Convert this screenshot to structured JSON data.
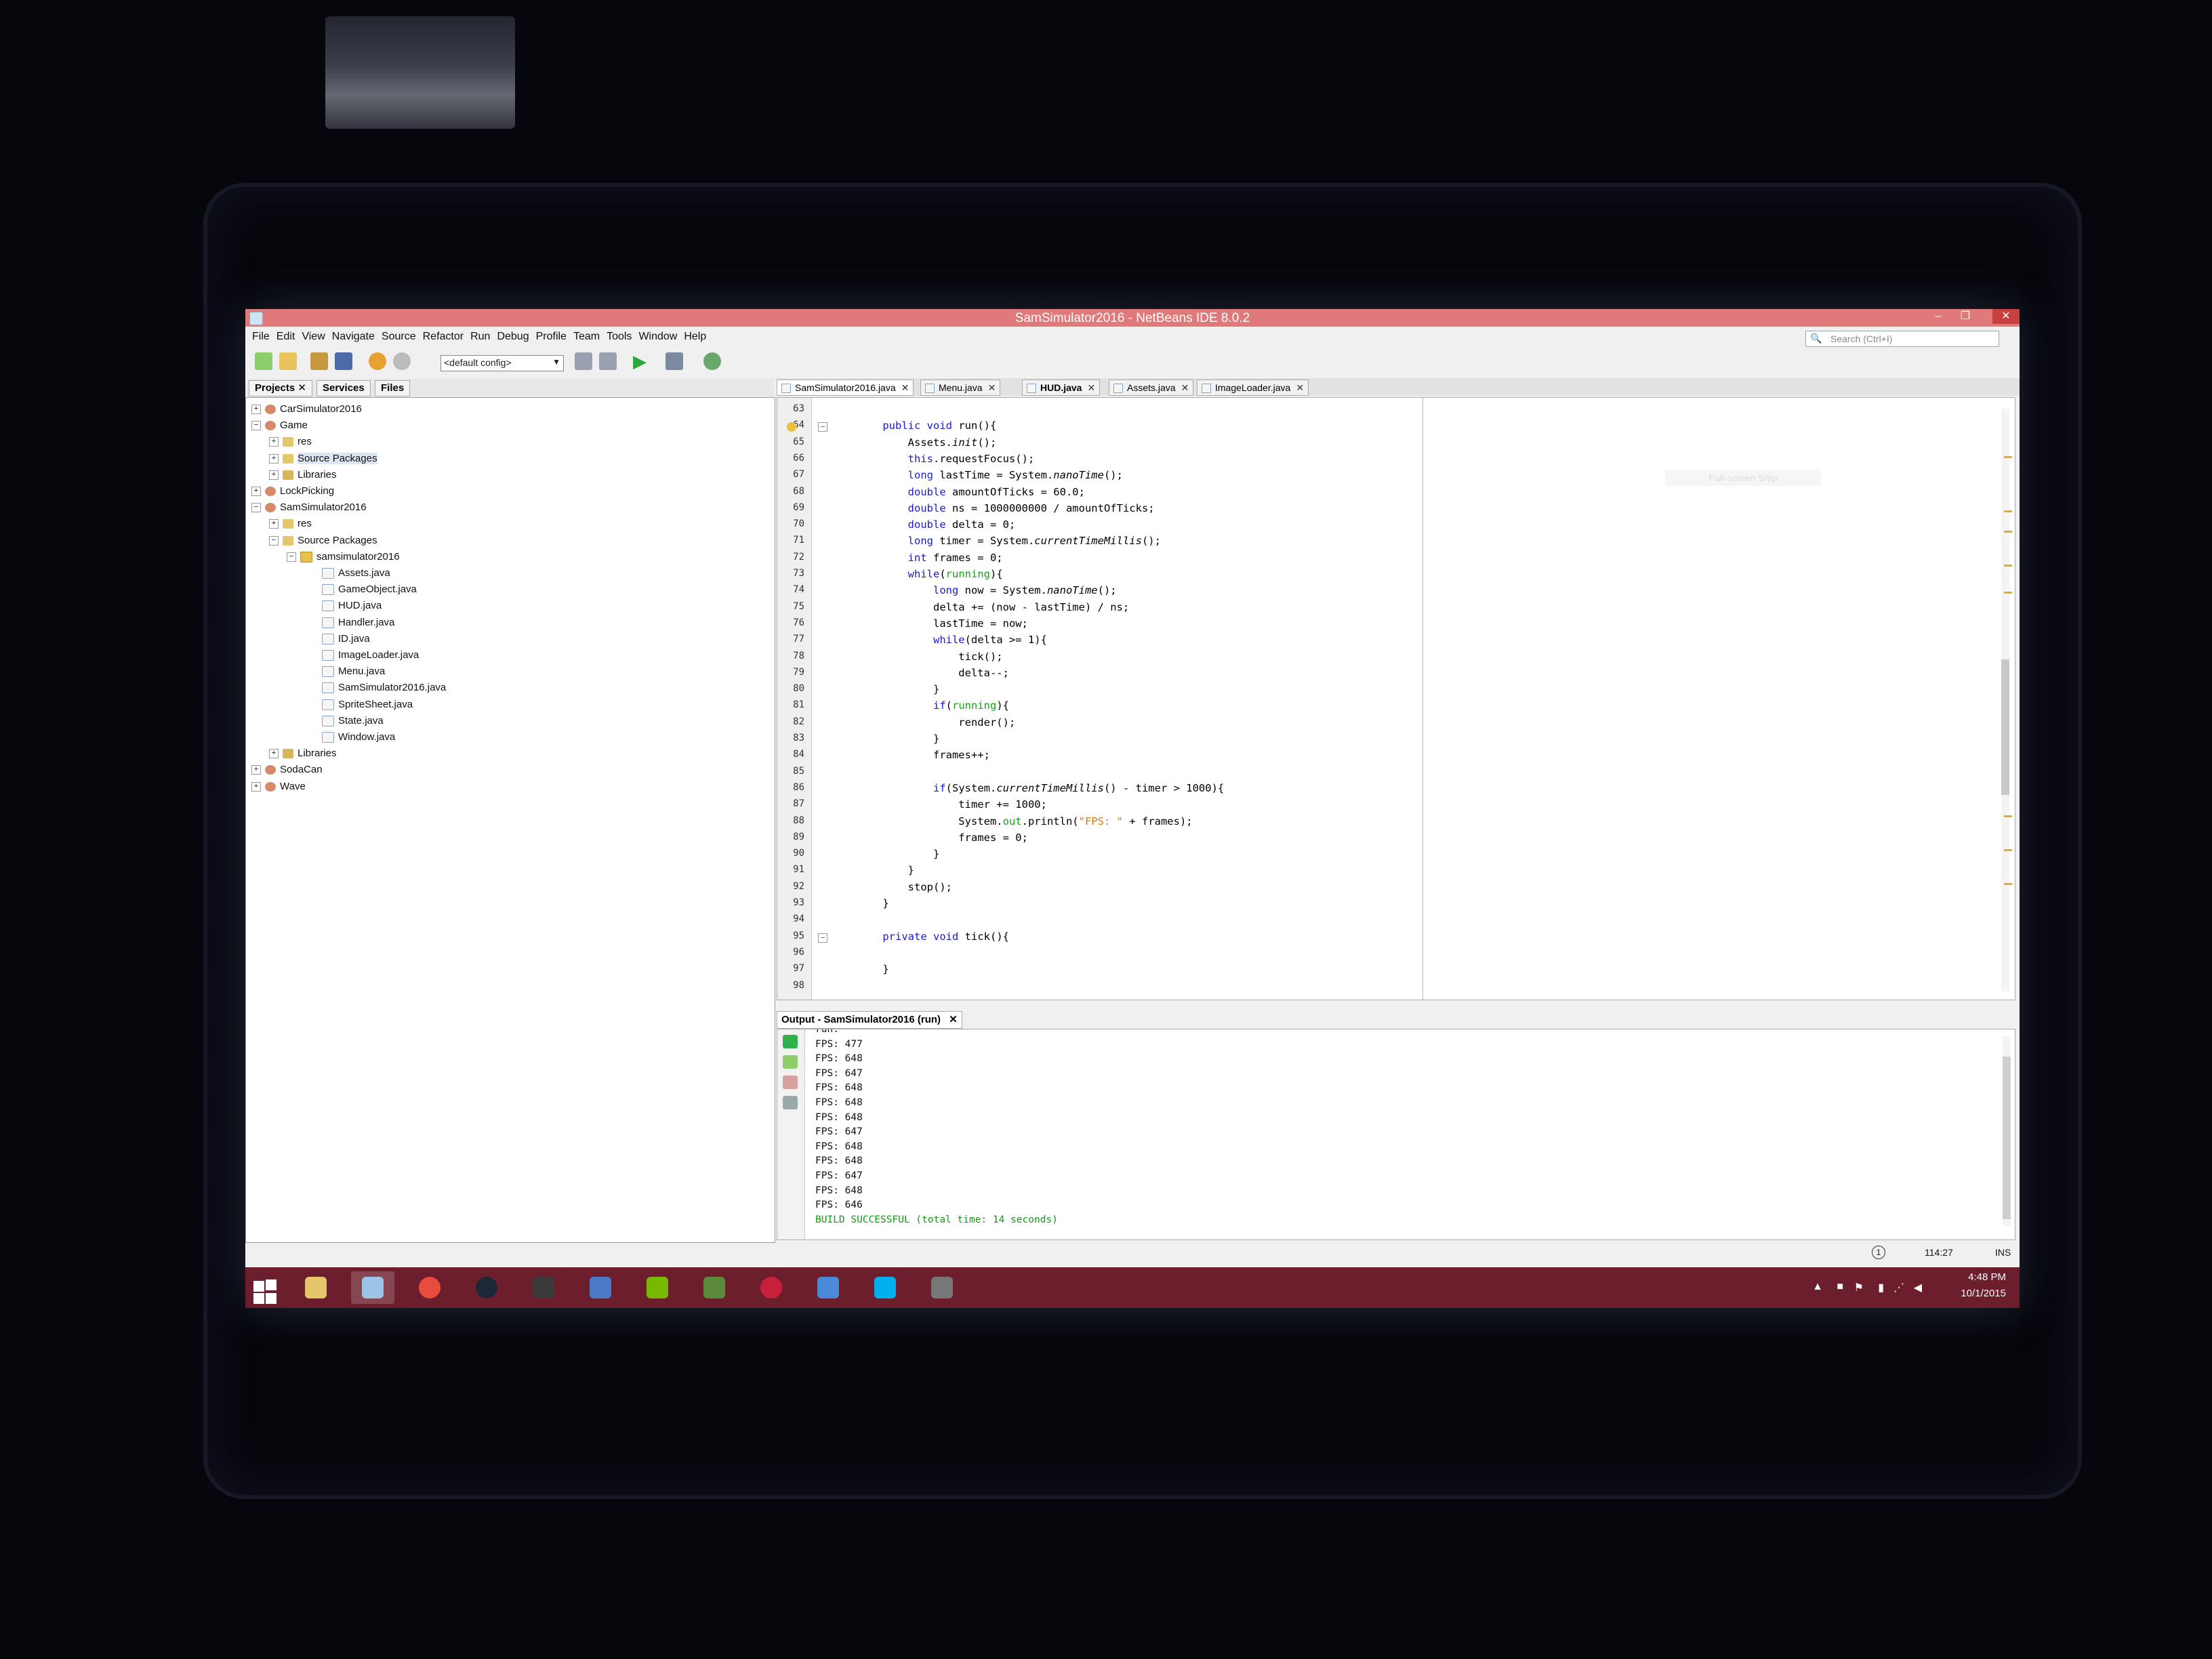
{
  "window": {
    "title": "SamSimulator2016 - NetBeans IDE 8.0.2",
    "min": "–",
    "max": "❐",
    "close": "✕"
  },
  "menu": [
    "File",
    "Edit",
    "View",
    "Navigate",
    "Source",
    "Refactor",
    "Run",
    "Debug",
    "Profile",
    "Team",
    "Tools",
    "Window",
    "Help"
  ],
  "search": {
    "placeholder": "Search (Ctrl+I)"
  },
  "toolbar": {
    "config": "<default config>"
  },
  "projects_panel": {
    "tabs": [
      "Projects",
      "Services",
      "Files"
    ],
    "tree": [
      {
        "label": "CarSimulator2016",
        "depth": 0,
        "type": "proj",
        "exp": "+"
      },
      {
        "label": "Game",
        "depth": 0,
        "type": "proj",
        "exp": "−"
      },
      {
        "label": "res",
        "depth": 1,
        "type": "folder",
        "exp": "+"
      },
      {
        "label": "Source Packages",
        "depth": 1,
        "type": "folder",
        "exp": "+",
        "selected": true
      },
      {
        "label": "Libraries",
        "depth": 1,
        "type": "lib",
        "exp": "+"
      },
      {
        "label": "LockPicking",
        "depth": 0,
        "type": "proj",
        "exp": "+"
      },
      {
        "label": "SamSimulator2016",
        "depth": 0,
        "type": "proj",
        "exp": "−"
      },
      {
        "label": "res",
        "depth": 1,
        "type": "folder",
        "exp": "+"
      },
      {
        "label": "Source Packages",
        "depth": 1,
        "type": "folder",
        "exp": "−"
      },
      {
        "label": "samsimulator2016",
        "depth": 2,
        "type": "pkg",
        "exp": "−"
      },
      {
        "label": "Assets.java",
        "depth": 3,
        "type": "java"
      },
      {
        "label": "GameObject.java",
        "depth": 3,
        "type": "java"
      },
      {
        "label": "HUD.java",
        "depth": 3,
        "type": "java"
      },
      {
        "label": "Handler.java",
        "depth": 3,
        "type": "java"
      },
      {
        "label": "ID.java",
        "depth": 3,
        "type": "java"
      },
      {
        "label": "ImageLoader.java",
        "depth": 3,
        "type": "java"
      },
      {
        "label": "Menu.java",
        "depth": 3,
        "type": "java"
      },
      {
        "label": "SamSimulator2016.java",
        "depth": 3,
        "type": "java"
      },
      {
        "label": "SpriteSheet.java",
        "depth": 3,
        "type": "java"
      },
      {
        "label": "State.java",
        "depth": 3,
        "type": "java"
      },
      {
        "label": "Window.java",
        "depth": 3,
        "type": "java"
      },
      {
        "label": "Libraries",
        "depth": 1,
        "type": "lib",
        "exp": "+"
      },
      {
        "label": "SodaCan",
        "depth": 0,
        "type": "proj",
        "exp": "+"
      },
      {
        "label": "Wave",
        "depth": 0,
        "type": "proj",
        "exp": "+"
      }
    ]
  },
  "editor_tabs": [
    {
      "label": "SamSimulator2016.java",
      "active": true
    },
    {
      "label": "Menu.java",
      "active": false
    },
    {
      "label": "HUD.java",
      "active": false,
      "bold": true
    },
    {
      "label": "Assets.java",
      "active": false
    },
    {
      "label": "ImageLoader.java",
      "active": false
    }
  ],
  "overlay_text": "Full-screen Snip",
  "code": [
    {
      "n": "63",
      "t": ""
    },
    {
      "n": "64",
      "t": "    <k>public</k> <k>void</k> run(){",
      "fold": "−"
    },
    {
      "n": "65",
      "t": "        Assets.<i>init</i>();"
    },
    {
      "n": "66",
      "t": "        <k>this</k>.requestFocus();"
    },
    {
      "n": "67",
      "t": "        <k>long</k> lastTime = System.<i>nanoTime</i>();"
    },
    {
      "n": "68",
      "t": "        <k>double</k> amountOfTicks = 60.0;"
    },
    {
      "n": "69",
      "t": "        <k>double</k> ns = 1000000000 / amountOfTicks;"
    },
    {
      "n": "70",
      "t": "        <k>double</k> delta = 0;"
    },
    {
      "n": "71",
      "t": "        <k>long</k> timer = System.<i>currentTimeMillis</i>();"
    },
    {
      "n": "72",
      "t": "        <k>int</k> frames = 0;"
    },
    {
      "n": "73",
      "t": "        <k>while</k>(<g>running</g>){"
    },
    {
      "n": "74",
      "t": "            <k>long</k> now = System.<i>nanoTime</i>();"
    },
    {
      "n": "75",
      "t": "            delta += (now - lastTime) / ns;"
    },
    {
      "n": "76",
      "t": "            lastTime = now;"
    },
    {
      "n": "77",
      "t": "            <k>while</k>(delta >= 1){"
    },
    {
      "n": "78",
      "t": "                tick();"
    },
    {
      "n": "79",
      "t": "                delta--;"
    },
    {
      "n": "80",
      "t": "            }"
    },
    {
      "n": "81",
      "t": "            <k>if</k>(<g>running</g>){"
    },
    {
      "n": "82",
      "t": "                render();"
    },
    {
      "n": "83",
      "t": "            }"
    },
    {
      "n": "84",
      "t": "            frames++;"
    },
    {
      "n": "85",
      "t": ""
    },
    {
      "n": "86",
      "t": "            <k>if</k>(System.<i>currentTimeMillis</i>() - timer > 1000){"
    },
    {
      "n": "87",
      "t": "                timer += 1000;"
    },
    {
      "n": "88",
      "t": "                System.<g>out</g>.println(<s>\"FPS: \"</s> + frames);"
    },
    {
      "n": "89",
      "t": "                frames = 0;"
    },
    {
      "n": "90",
      "t": "            }"
    },
    {
      "n": "91",
      "t": "        }"
    },
    {
      "n": "92",
      "t": "        stop();"
    },
    {
      "n": "93",
      "t": "    }"
    },
    {
      "n": "94",
      "t": ""
    },
    {
      "n": "95",
      "t": "    <k>private</k> <k>void</k> tick(){",
      "fold": "−"
    },
    {
      "n": "96",
      "t": ""
    },
    {
      "n": "97",
      "t": "    }"
    },
    {
      "n": "98",
      "t": ""
    }
  ],
  "output": {
    "tab": "Output - SamSimulator2016 (run)",
    "lines": [
      "run:",
      "FPS: 477",
      "FPS: 648",
      "FPS: 647",
      "FPS: 648",
      "FPS: 648",
      "FPS: 648",
      "FPS: 647",
      "FPS: 648",
      "FPS: 648",
      "FPS: 647",
      "FPS: 648",
      "FPS: 646"
    ],
    "result": "BUILD SUCCESSFUL (total time: 14 seconds)"
  },
  "status": {
    "position": "114:27",
    "mode": "INS"
  },
  "taskbar": {
    "apps": [
      "file-explorer",
      "netbeans",
      "chrome",
      "steam",
      "game-app",
      "media-player",
      "nvidia",
      "minecraft",
      "app-101",
      "paint",
      "skype",
      "camera"
    ],
    "time": "4:48 PM",
    "date": "10/1/2015"
  }
}
